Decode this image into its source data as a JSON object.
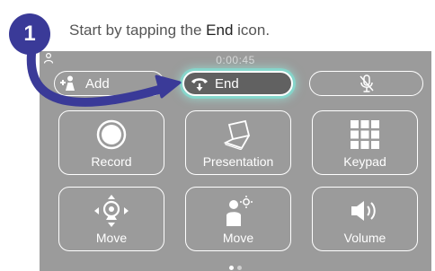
{
  "step": {
    "number": "1",
    "text_before": "Start by tapping the",
    "emphasis": "End",
    "text_after": "icon.",
    "badge_color": "#3a3a98"
  },
  "screen": {
    "timer": "0:00:45",
    "background": "#9b9b9b",
    "top_bar": {
      "add_label": "Add",
      "end_label": "End",
      "mute_icon": "microphone-muted-icon"
    },
    "tiles": [
      {
        "label": "Record",
        "icon": "record-icon"
      },
      {
        "label": "Presentation",
        "icon": "laptop-icon"
      },
      {
        "label": "Keypad",
        "icon": "keypad-icon"
      },
      {
        "label": "Move",
        "icon": "camera-move-icon"
      },
      {
        "label": "Move",
        "icon": "person-camera-icon"
      },
      {
        "label": "Volume",
        "icon": "speaker-icon"
      }
    ],
    "page_count": 2,
    "active_page": 1,
    "highlight_color": "#78ebdc",
    "arrow_color": "#3a3a98"
  }
}
